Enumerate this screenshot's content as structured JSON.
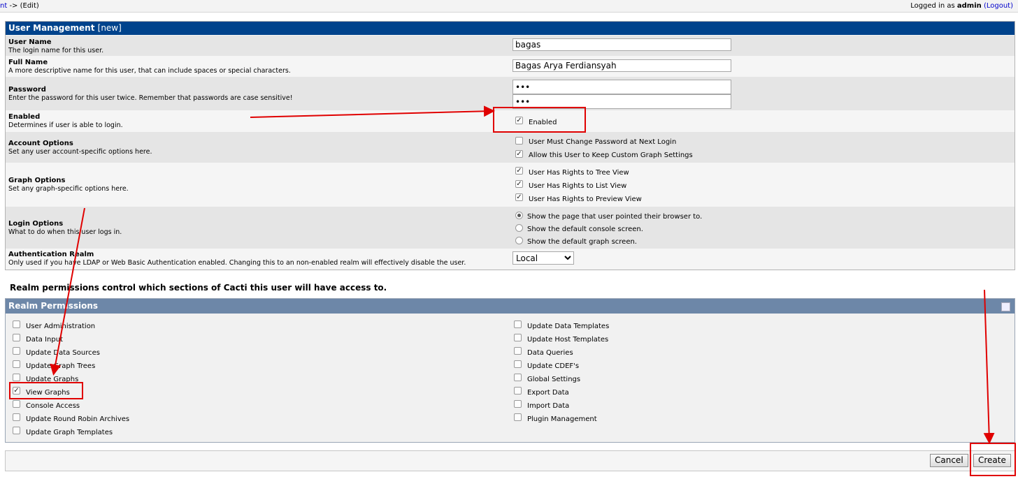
{
  "topbar": {
    "breadcrumb_link": "nt",
    "breadcrumb_rest": " -> (Edit)",
    "logged_prefix": "Logged in as ",
    "user": "admin",
    "logout": "(Logout)"
  },
  "form": {
    "title": "User Management",
    "title_suffix": "[new]",
    "username": {
      "label": "User Name",
      "desc": "The login name for this user.",
      "value": "bagas"
    },
    "fullname": {
      "label": "Full Name",
      "desc": "A more descriptive name for this user, that can include spaces or special characters.",
      "value": "Bagas Arya Ferdiansyah"
    },
    "password": {
      "label": "Password",
      "desc": "Enter the password for this user twice. Remember that passwords are case sensitive!",
      "value1": "•••",
      "value2": "•••"
    },
    "enabled": {
      "label": "Enabled",
      "desc": "Determines if user is able to login.",
      "option": "Enabled",
      "checked": true
    },
    "account": {
      "label": "Account Options",
      "desc": "Set any user account-specific options here.",
      "options": [
        {
          "label": "User Must Change Password at Next Login",
          "checked": false
        },
        {
          "label": "Allow this User to Keep Custom Graph Settings",
          "checked": true
        }
      ]
    },
    "graph": {
      "label": "Graph Options",
      "desc": "Set any graph-specific options here.",
      "options": [
        {
          "label": "User Has Rights to Tree View",
          "checked": true
        },
        {
          "label": "User Has Rights to List View",
          "checked": true
        },
        {
          "label": "User Has Rights to Preview View",
          "checked": true
        }
      ]
    },
    "login": {
      "label": "Login Options",
      "desc": "What to do when this user logs in.",
      "options": [
        {
          "label": "Show the page that user pointed their browser to.",
          "selected": true
        },
        {
          "label": "Show the default console screen.",
          "selected": false
        },
        {
          "label": "Show the default graph screen.",
          "selected": false
        }
      ]
    },
    "realm": {
      "label": "Authentication Realm",
      "desc": "Only used if you have LDAP or Web Basic Authentication enabled. Changing this to an non-enabled realm will effectively disable the user.",
      "value": "Local"
    }
  },
  "realm_intro": "Realm permissions control which sections of Cacti this user will have access to.",
  "realm_permissions": {
    "title": "Realm Permissions",
    "left": [
      {
        "label": "User Administration",
        "checked": false
      },
      {
        "label": "Data Input",
        "checked": false
      },
      {
        "label": "Update Data Sources",
        "checked": false
      },
      {
        "label": "Update Graph Trees",
        "checked": false
      },
      {
        "label": "Update Graphs",
        "checked": false
      },
      {
        "label": "View Graphs",
        "checked": true
      },
      {
        "label": "Console Access",
        "checked": false
      },
      {
        "label": "Update Round Robin Archives",
        "checked": false
      },
      {
        "label": "Update Graph Templates",
        "checked": false
      }
    ],
    "right": [
      {
        "label": "Update Data Templates",
        "checked": false
      },
      {
        "label": "Update Host Templates",
        "checked": false
      },
      {
        "label": "Data Queries",
        "checked": false
      },
      {
        "label": "Update CDEF's",
        "checked": false
      },
      {
        "label": "Global Settings",
        "checked": false
      },
      {
        "label": "Export Data",
        "checked": false
      },
      {
        "label": "Import Data",
        "checked": false
      },
      {
        "label": "Plugin Management",
        "checked": false
      }
    ]
  },
  "actions": {
    "cancel": "Cancel",
    "create": "Create"
  },
  "colors": {
    "annotation": "#e00000",
    "header": "#00438c",
    "realm_header": "#6d87a8"
  }
}
